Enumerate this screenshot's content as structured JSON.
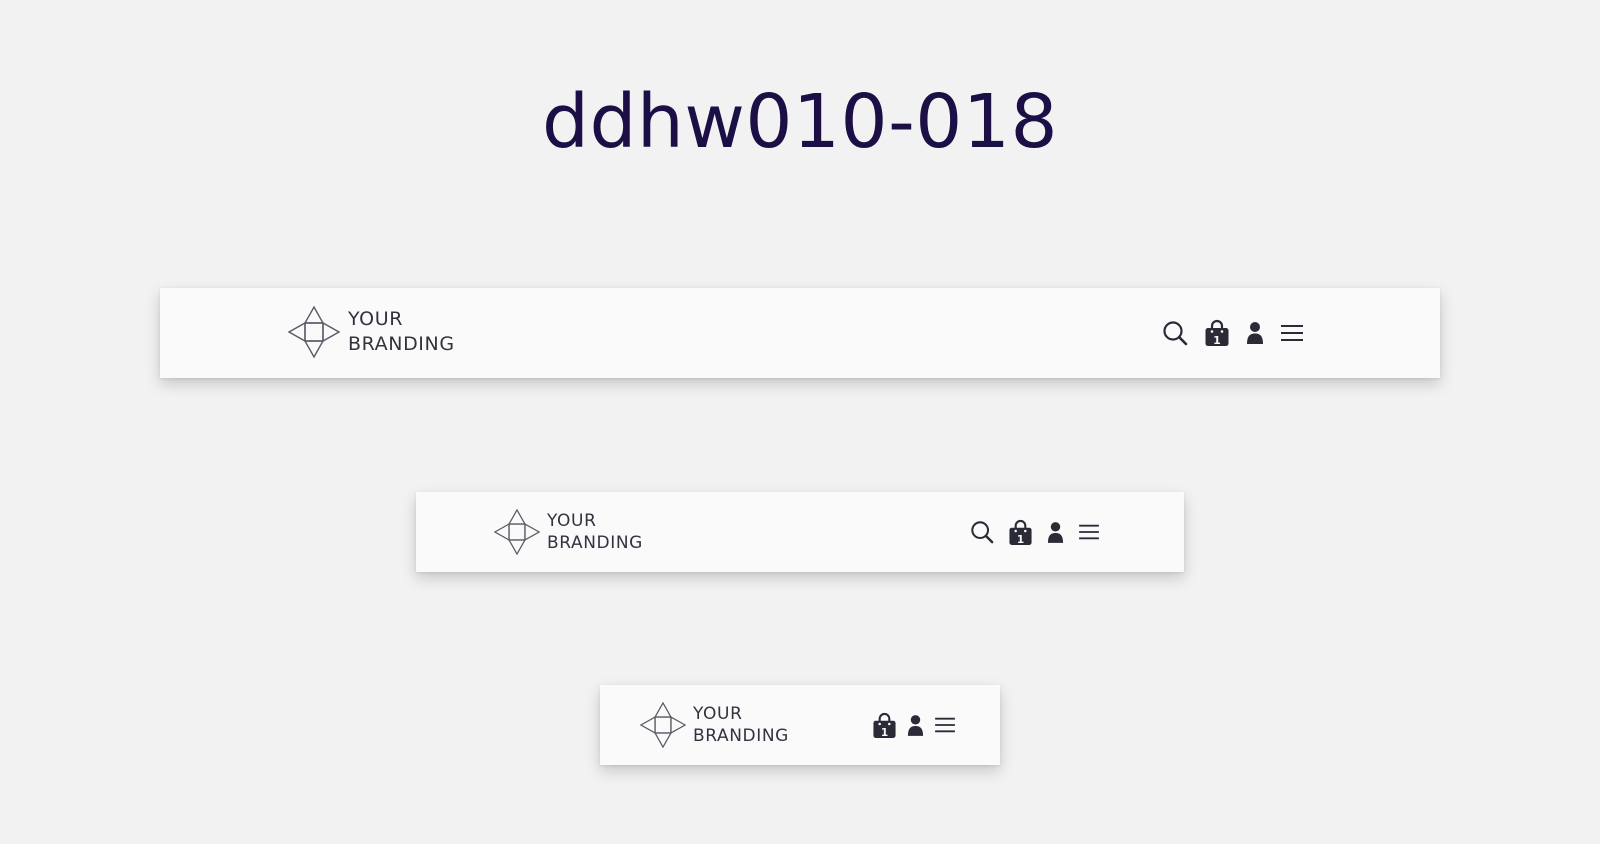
{
  "page": {
    "title": "ddhw010-018"
  },
  "brand": {
    "line1": "YOUR",
    "line2": "BRANDING",
    "logo_icon": "diamond-arrows-logo-icon"
  },
  "navbars": {
    "large": {
      "icons": [
        "search-icon",
        "shopping-bag-icon",
        "user-icon",
        "menu-icon"
      ],
      "cart_count": "1"
    },
    "medium": {
      "icons": [
        "search-icon",
        "shopping-bag-icon",
        "user-icon",
        "menu-icon"
      ],
      "cart_count": "1"
    },
    "small": {
      "icons": [
        "shopping-bag-icon",
        "user-icon",
        "menu-icon"
      ],
      "cart_count": "1"
    }
  },
  "colors": {
    "background": "#f2f2f2",
    "navbar_bg": "#fafafa",
    "title": "#1c0f45",
    "brand_text": "#33323f",
    "icon": "#2b2b38",
    "logo_stroke": "#5a5a66"
  }
}
